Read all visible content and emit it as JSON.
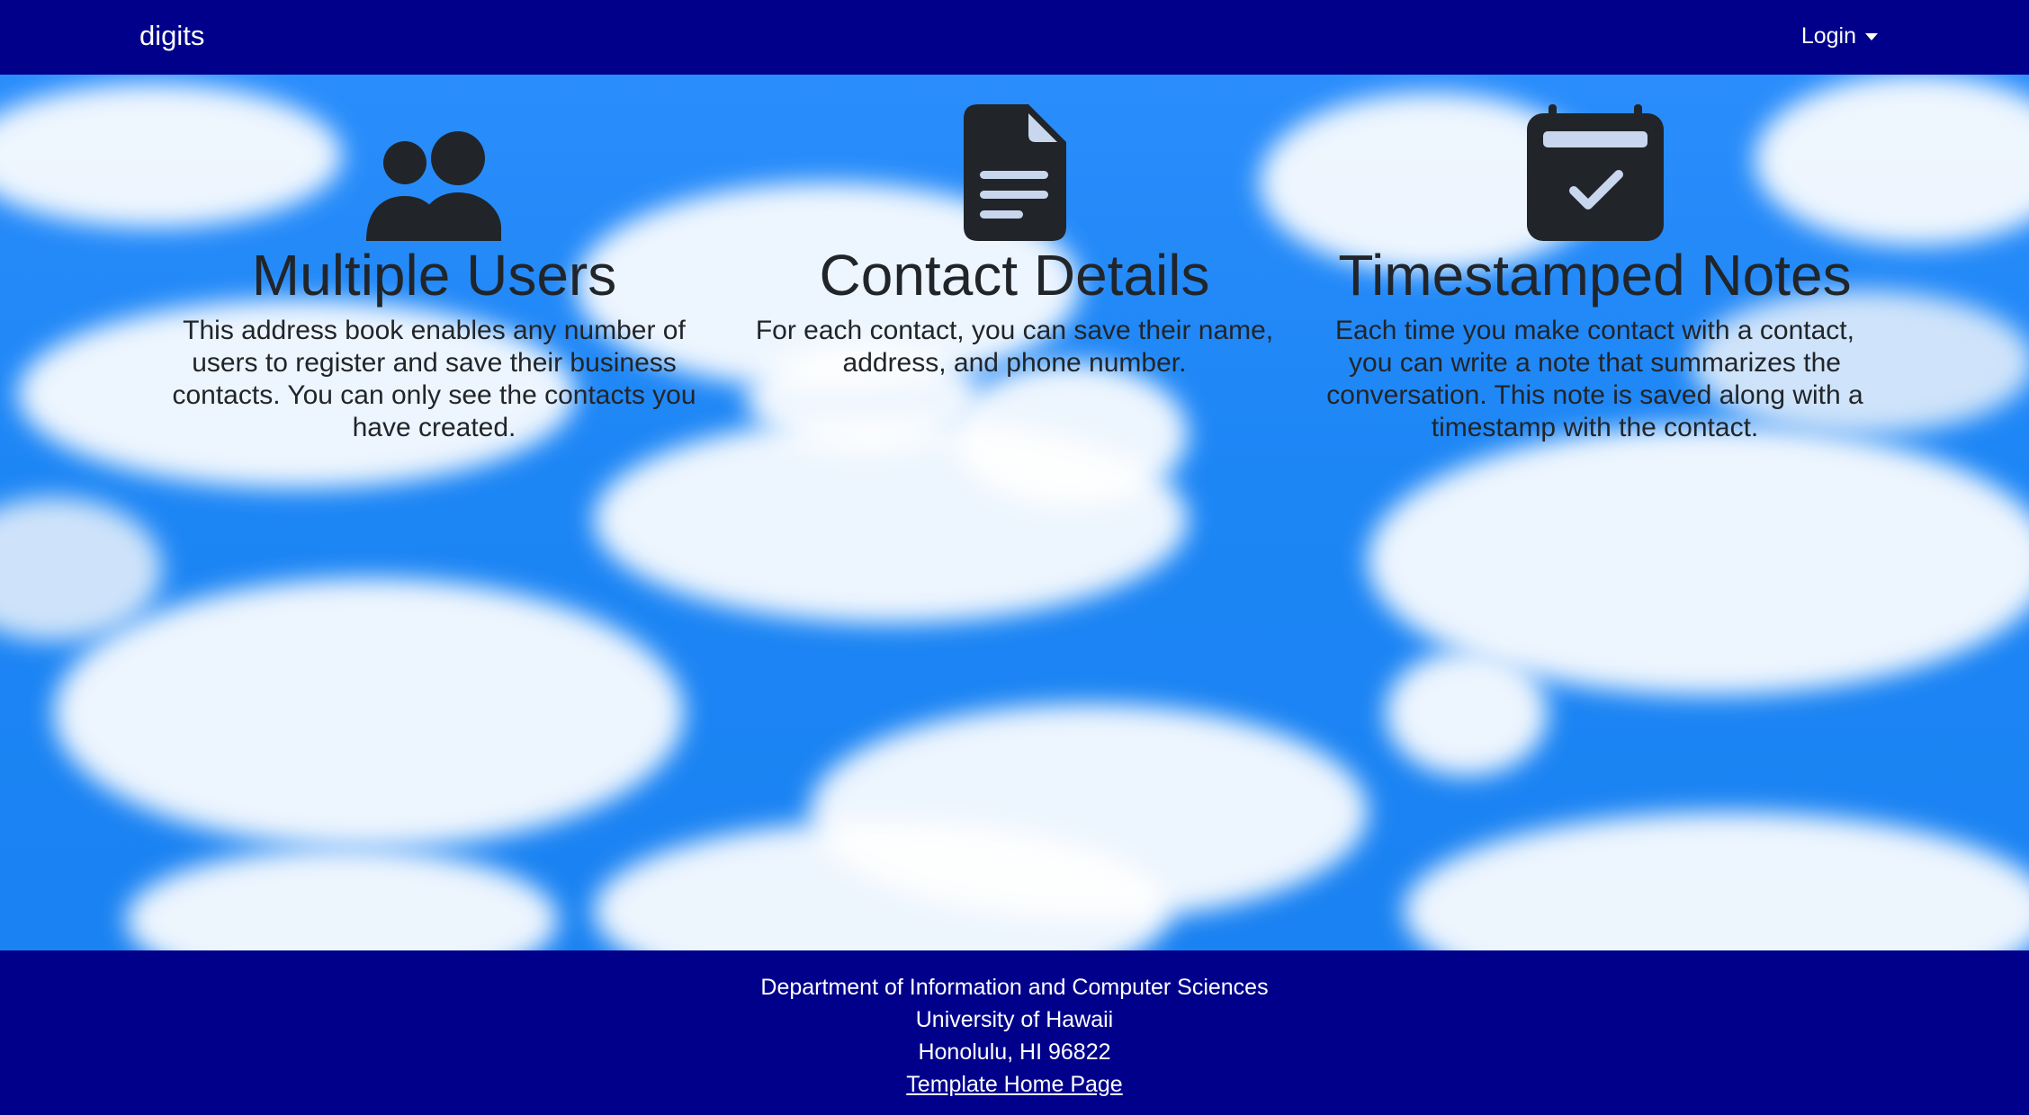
{
  "navbar": {
    "brand": "digits",
    "login_label": "Login",
    "background": "#00008b"
  },
  "features": [
    {
      "icon": "users-icon",
      "title": "Multiple Users",
      "text": "This address book enables any number of users to register and save their business contacts. You can only see the contacts you have created."
    },
    {
      "icon": "file-text-icon",
      "title": "Contact Details",
      "text": "For each contact, you can save their name, address, and phone number."
    },
    {
      "icon": "calendar-check-icon",
      "title": "Timestamped Notes",
      "text": "Each time you make contact with a contact, you can write a note that summarizes the conversation. This note is saved along with a timestamp with the contact."
    }
  ],
  "footer": {
    "line1": "Department of Information and Computer Sciences",
    "line2": "University of Hawaii",
    "line3": "Honolulu, HI 96822",
    "link": "Template Home Page",
    "background": "#00008b"
  }
}
